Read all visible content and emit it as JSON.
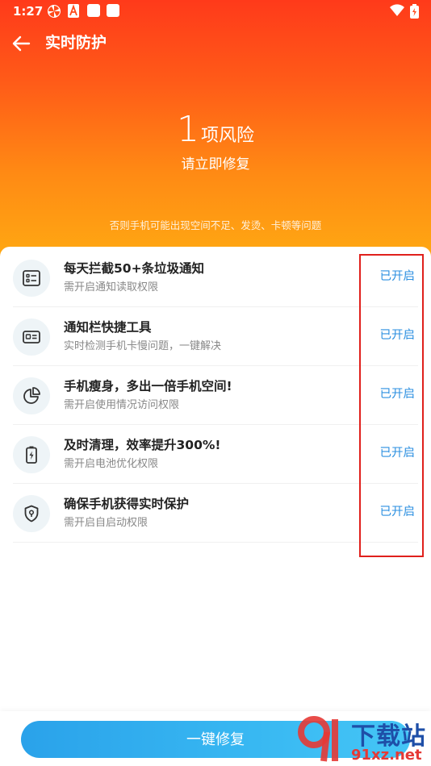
{
  "status_bar": {
    "time": "1:27",
    "icons": [
      "pinwheel-icon",
      "adobe-icon",
      "square-icon",
      "square-icon",
      "wifi-icon",
      "battery-charging-icon"
    ]
  },
  "header": {
    "back_icon": "arrow-left-icon",
    "title": "实时防护"
  },
  "risk": {
    "count": "1",
    "label": "项风险",
    "subtitle": "请立即修复",
    "note": "否则手机可能出现空间不足、发烫、卡顿等问题"
  },
  "features": [
    {
      "icon": "list-card-icon",
      "title": "每天拦截50+条垃圾通知",
      "desc": "需开启通知读取权限",
      "status": "已开启"
    },
    {
      "icon": "id-card-icon",
      "title": "通知栏快捷工具",
      "desc": "实时检测手机卡慢问题，一键解决",
      "status": "已开启"
    },
    {
      "icon": "pie-chart-icon",
      "title": "手机瘦身，多出一倍手机空间!",
      "desc": "需开启使用情况访问权限",
      "status": "已开启"
    },
    {
      "icon": "battery-bolt-icon",
      "title": "及时清理，效率提升300%!",
      "desc": "需开启电池优化权限",
      "status": "已开启"
    },
    {
      "icon": "shield-icon",
      "title": "确保手机获得实时保护",
      "desc": "需开启自启动权限",
      "status": "已开启"
    }
  ],
  "bottom": {
    "button_label": "一键修复"
  },
  "watermark": {
    "logo_text": "下载站",
    "site": "91xz.net",
    "digits": "9"
  },
  "colors": {
    "hero_top": "#ff3a1a",
    "hero_bottom": "#ffab12",
    "status_enabled": "#2b8fe0",
    "button": "#38b8f2",
    "highlight": "#e0201c"
  }
}
